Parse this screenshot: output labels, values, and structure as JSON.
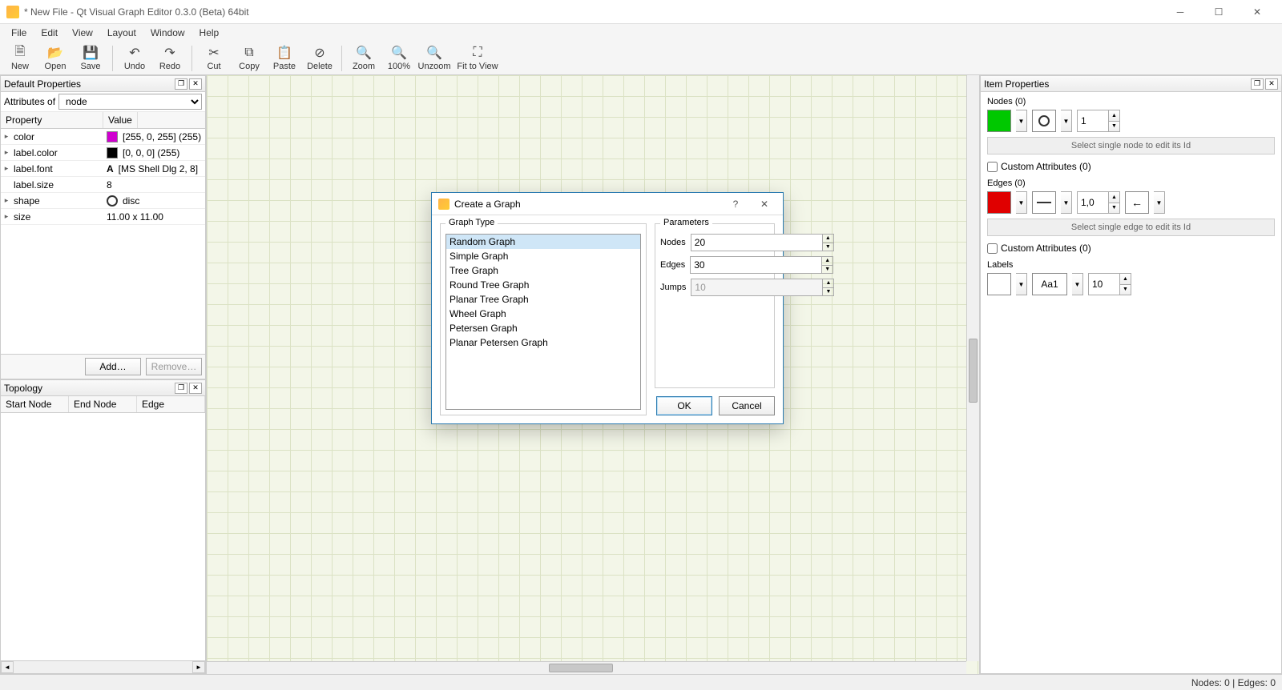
{
  "window": {
    "title": "* New File - Qt Visual Graph Editor 0.3.0 (Beta) 64bit"
  },
  "menu": {
    "items": [
      "File",
      "Edit",
      "View",
      "Layout",
      "Window",
      "Help"
    ]
  },
  "toolbar": {
    "new": "New",
    "open": "Open",
    "save": "Save",
    "undo": "Undo",
    "redo": "Redo",
    "cut": "Cut",
    "copy": "Copy",
    "paste": "Paste",
    "delete": "Delete",
    "zoom": "Zoom",
    "zoom100": "100%",
    "unzoom": "Unzoom",
    "fit": "Fit to View"
  },
  "left": {
    "default_props_title": "Default Properties",
    "attributes_of_label": "Attributes of",
    "attributes_of_value": "node",
    "prop_header_key": "Property",
    "prop_header_val": "Value",
    "rows": [
      {
        "key": "color",
        "val": "[255, 0, 255] (255)",
        "swatch": "#d000d0",
        "expand": true
      },
      {
        "key": "label.color",
        "val": "[0, 0, 0] (255)",
        "swatch": "#000000",
        "expand": true
      },
      {
        "key": "label.font",
        "val": "[MS Shell Dlg 2, 8]",
        "icon": "A",
        "expand": true
      },
      {
        "key": "label.size",
        "val": "8",
        "expand": false
      },
      {
        "key": "shape",
        "val": "disc",
        "disc": true,
        "expand": true
      },
      {
        "key": "size",
        "val": "11.00 x 11.00",
        "expand": true
      }
    ],
    "add_btn": "Add…",
    "remove_btn": "Remove…",
    "topology_title": "Topology",
    "topo_cols": [
      "Start Node",
      "End Node",
      "Edge"
    ]
  },
  "right": {
    "title": "Item Properties",
    "nodes_label": "Nodes (0)",
    "node_color": "#00c800",
    "node_size": "1",
    "node_hint": "Select single node to edit its Id",
    "node_custom": "Custom Attributes (0)",
    "edges_label": "Edges (0)",
    "edge_color": "#e00000",
    "edge_weight": "1,0",
    "edge_hint": "Select single edge to edit its Id",
    "edge_custom": "Custom Attributes (0)",
    "labels_label": "Labels",
    "label_color": "#ffffff",
    "label_font": "Aa1",
    "label_size": "10"
  },
  "dialog": {
    "title": "Create a Graph",
    "graph_type_label": "Graph Type",
    "types": [
      "Random Graph",
      "Simple Graph",
      "Tree Graph",
      "Round Tree Graph",
      "Planar Tree Graph",
      "Wheel Graph",
      "Petersen Graph",
      "Planar Petersen Graph"
    ],
    "selected_index": 0,
    "parameters_label": "Parameters",
    "param_nodes_label": "Nodes",
    "param_nodes_value": "20",
    "param_edges_label": "Edges",
    "param_edges_value": "30",
    "param_jumps_label": "Jumps",
    "param_jumps_value": "10",
    "ok": "OK",
    "cancel": "Cancel"
  },
  "status": {
    "text": "Nodes: 0 | Edges: 0"
  }
}
